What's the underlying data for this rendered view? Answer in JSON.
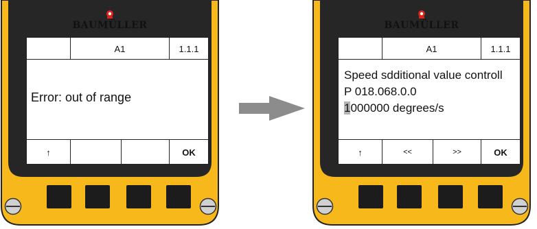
{
  "colors": {
    "housing": "#f7b81b",
    "bezel": "#262626",
    "screen": "#ffffff",
    "button": "#1c1c1c",
    "arrow": "#8c8c8c",
    "cursor": "#b5b5b5"
  },
  "devices": [
    {
      "brand": "BAUMÜLLER",
      "header": {
        "left": "",
        "center": "A1",
        "right": "1.1.1"
      },
      "message": "Error: out of range",
      "softkeys": [
        "↑",
        "",
        "",
        "OK"
      ]
    },
    {
      "brand": "BAUMÜLLER",
      "header": {
        "left": "",
        "center": "A1",
        "right": "1.1.1"
      },
      "lines": {
        "line1": "Speed sdditional value controll",
        "line2": "P 018.068.0.0",
        "cursor_char": "1",
        "line3_rest": "000000 degrees/s"
      },
      "softkeys": [
        "↑",
        "<<",
        ">>",
        "OK"
      ]
    }
  ],
  "icons": {
    "logo": "baumuller-logo-icon",
    "screw": "screw-icon",
    "arrow": "right-arrow-icon"
  }
}
